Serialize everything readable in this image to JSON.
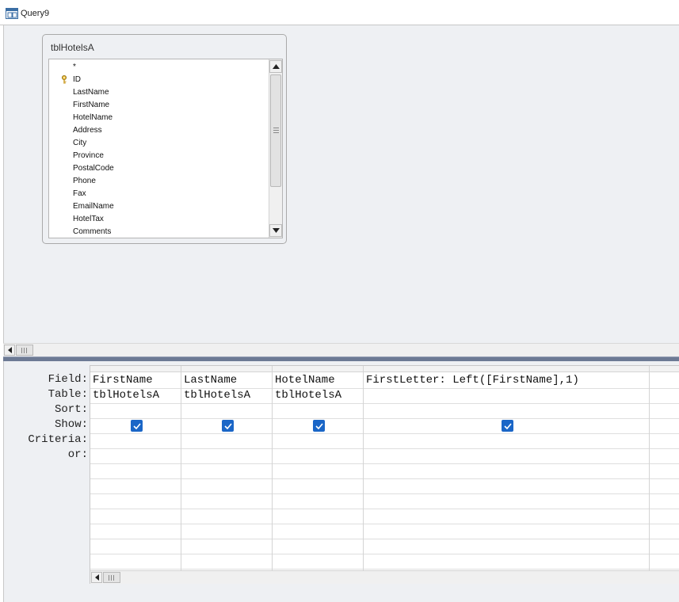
{
  "window": {
    "title": "Query9",
    "icon": "query-design-icon"
  },
  "table_window": {
    "title": "tblHotelsA",
    "fields": [
      {
        "name": "*",
        "is_key": false
      },
      {
        "name": "ID",
        "is_key": true
      },
      {
        "name": "LastName",
        "is_key": false
      },
      {
        "name": "FirstName",
        "is_key": false
      },
      {
        "name": "HotelName",
        "is_key": false
      },
      {
        "name": "Address",
        "is_key": false
      },
      {
        "name": "City",
        "is_key": false
      },
      {
        "name": "Province",
        "is_key": false
      },
      {
        "name": "PostalCode",
        "is_key": false
      },
      {
        "name": "Phone",
        "is_key": false
      },
      {
        "name": "Fax",
        "is_key": false
      },
      {
        "name": "EmailName",
        "is_key": false
      },
      {
        "name": "HotelTax",
        "is_key": false
      },
      {
        "name": "Comments",
        "is_key": false
      }
    ]
  },
  "grid": {
    "row_labels": [
      "Field:",
      "Table:",
      "Sort:",
      "Show:",
      "Criteria:",
      "or:"
    ],
    "columns": [
      {
        "field": "FirstName",
        "table": "tblHotelsA",
        "sort": "",
        "show": true
      },
      {
        "field": "LastName",
        "table": "tblHotelsA",
        "sort": "",
        "show": true
      },
      {
        "field": "HotelName",
        "table": "tblHotelsA",
        "sort": "",
        "show": true
      },
      {
        "field": "FirstLetter: Left([FirstName],1)",
        "table": "",
        "sort": "",
        "show": true
      },
      {
        "field": "",
        "table": "",
        "sort": "",
        "show": false
      }
    ]
  },
  "colors": {
    "checkbox": "#1a66c7",
    "splitter": "#6d7a94",
    "pane_bg": "#eef0f3"
  }
}
